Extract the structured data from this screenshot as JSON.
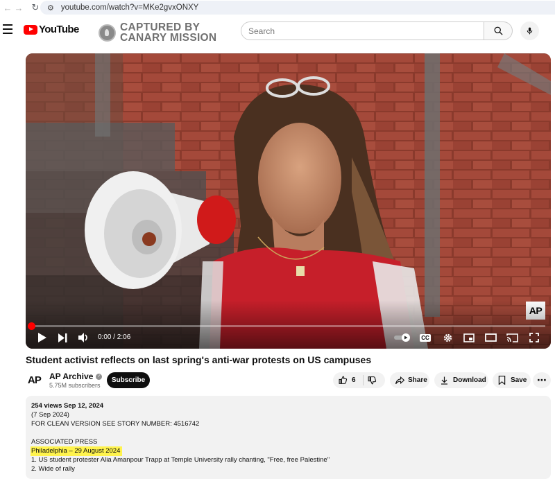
{
  "browser": {
    "url": "youtube.com/watch?v=MKe2gvxONXY"
  },
  "header": {
    "logo_text": "YouTube",
    "watermark_line1": "CAPTURED BY",
    "watermark_line2": "CANARY MISSION",
    "search_placeholder": "Search"
  },
  "player": {
    "badge": "AP",
    "time": "0:00 / 2:06",
    "progress_fraction": 0.0
  },
  "video": {
    "title": "Student activist reflects on last spring's anti-war protests on US campuses"
  },
  "channel": {
    "logo": "AP",
    "name": "AP Archive",
    "subscribers": "5.75M subscribers",
    "subscribe_label": "Subscribe"
  },
  "actions": {
    "like_count": "6",
    "share_label": "Share",
    "download_label": "Download",
    "save_label": "Save"
  },
  "description": {
    "meta": "254 views  Sep 12, 2024",
    "line1": "(7 Sep 2024)",
    "line2": "FOR CLEAN VERSION SEE STORY NUMBER: 4516742",
    "line3": "ASSOCIATED PRESS",
    "line4": "Philadelphia – 29 August 2024",
    "line5": "1. US student protester Alia Amanpour Trapp at Temple University rally chanting, \"Free, free Palestine\"",
    "line6": "2. Wide of rally"
  },
  "colors": {
    "brand_red": "#ff0000",
    "highlight": "#fff34d"
  }
}
